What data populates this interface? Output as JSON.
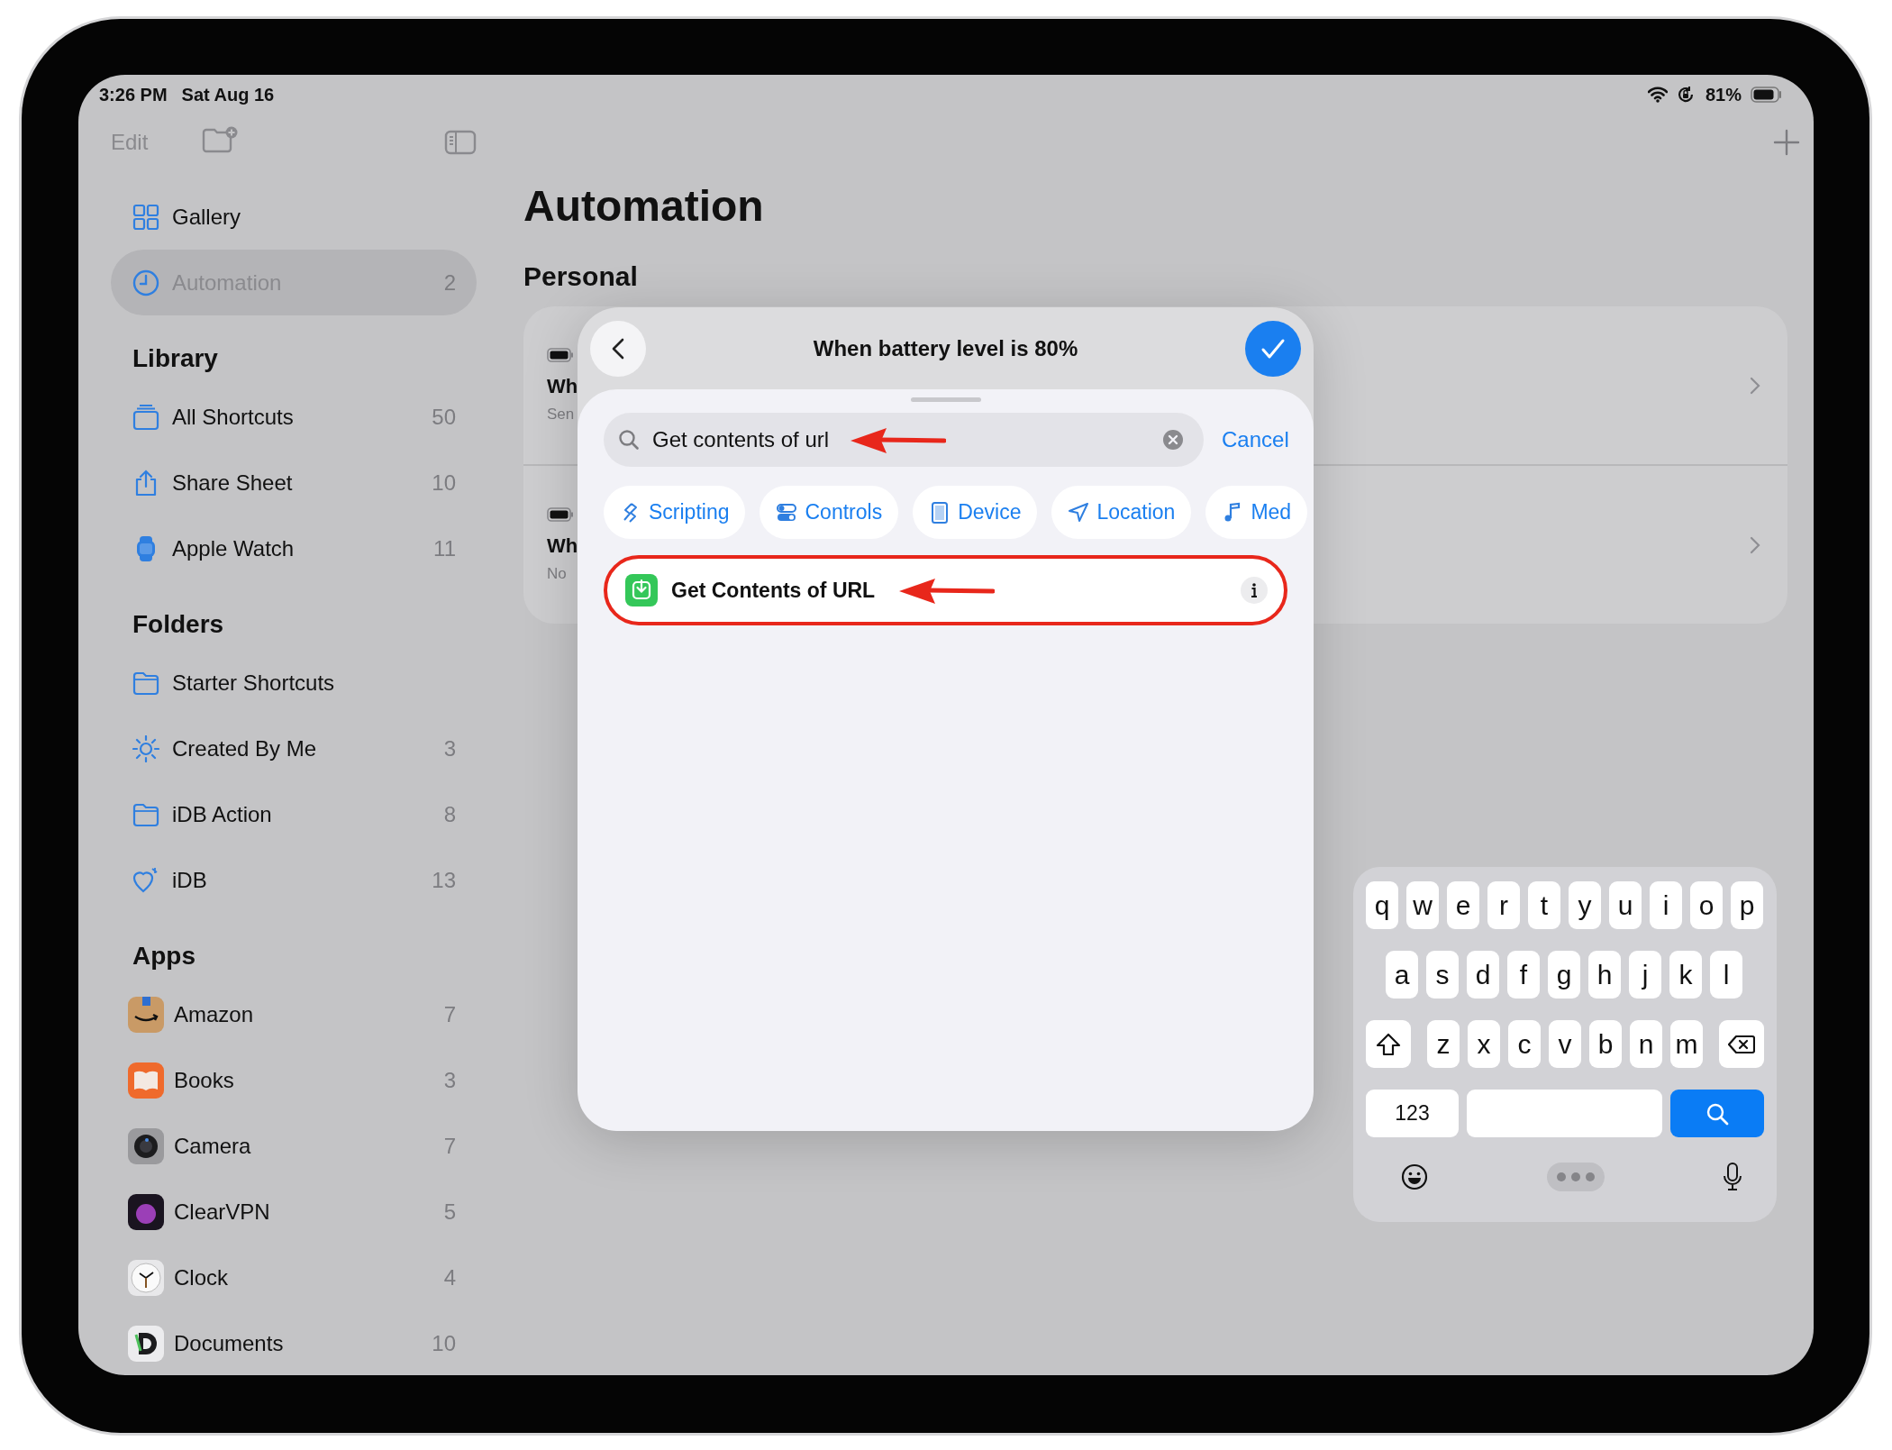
{
  "status_bar": {
    "time": "3:26 PM",
    "date": "Sat Aug 16",
    "battery": "81%"
  },
  "sidebar": {
    "edit": "Edit",
    "items": [
      {
        "label": "Gallery",
        "selected": false
      },
      {
        "label": "Automation",
        "count": "2",
        "selected": true
      }
    ],
    "sections": [
      {
        "title": "Library",
        "items": [
          {
            "label": "All Shortcuts",
            "count": "50",
            "selected": false
          },
          {
            "label": "Share Sheet",
            "count": "10",
            "selected": false
          },
          {
            "label": "Apple Watch",
            "count": "11",
            "selected": false
          }
        ]
      },
      {
        "title": "Folders",
        "items": [
          {
            "label": "Starter Shortcuts",
            "selected": false
          },
          {
            "label": "Created By Me",
            "count": "3",
            "selected": false
          },
          {
            "label": "iDB Action",
            "count": "8",
            "selected": false
          },
          {
            "label": "iDB",
            "count": "13",
            "selected": false
          }
        ]
      },
      {
        "title": "Apps",
        "items": [
          {
            "label": "Amazon",
            "count": "7",
            "selected": false
          },
          {
            "label": "Books",
            "count": "3",
            "selected": false
          },
          {
            "label": "Camera",
            "count": "7",
            "selected": false
          },
          {
            "label": "ClearVPN",
            "count": "5",
            "selected": false
          },
          {
            "label": "Clock",
            "count": "4",
            "selected": false
          },
          {
            "label": "Documents",
            "count": "10",
            "selected": false
          }
        ]
      }
    ]
  },
  "main": {
    "title": "Automation",
    "section": "Personal",
    "rows": [
      {
        "title": "Wh",
        "subtitle": "Sen"
      },
      {
        "title": "Wh",
        "subtitle": "No"
      }
    ]
  },
  "modal": {
    "title": "When battery level is 80%",
    "search": {
      "value": "Get contents of url"
    },
    "cancel": "Cancel",
    "chips": [
      "Scripting",
      "Controls",
      "Device",
      "Location",
      "Med"
    ],
    "results": [
      {
        "label": "Get Contents of URL",
        "highlighted": true
      }
    ]
  },
  "keyboard": {
    "rows": [
      [
        "q",
        "w",
        "e",
        "r",
        "t",
        "y",
        "u",
        "i",
        "o",
        "p"
      ],
      [
        "a",
        "s",
        "d",
        "f",
        "g",
        "h",
        "j",
        "k",
        "l"
      ],
      [
        "z",
        "x",
        "c",
        "v",
        "b",
        "n",
        "m"
      ]
    ],
    "numbers_key": "123"
  }
}
